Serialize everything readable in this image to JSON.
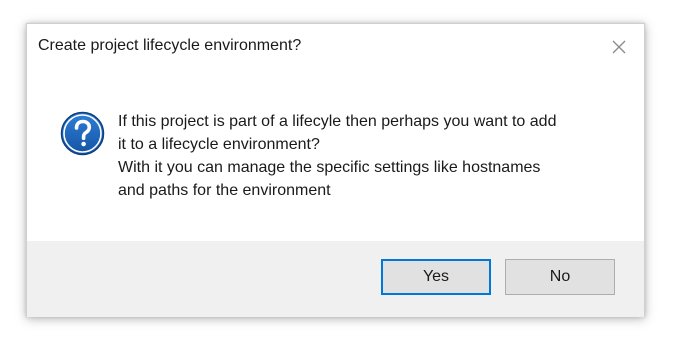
{
  "dialog": {
    "title": "Create project lifecycle environment?",
    "icon": "question-icon",
    "close_icon": "close-icon",
    "message_lines": [
      "If this project is part of a lifecyle then perhaps you want to add",
      "it to a lifecycle environment?",
      "With it you can manage the specific settings like hostnames",
      "and paths for the environment"
    ],
    "buttons": {
      "yes_label": "Yes",
      "no_label": "No"
    },
    "colors": {
      "accent": "#0078d7",
      "icon_fill": "#1c5fb0",
      "footer_bg": "#f0f0f0"
    }
  }
}
